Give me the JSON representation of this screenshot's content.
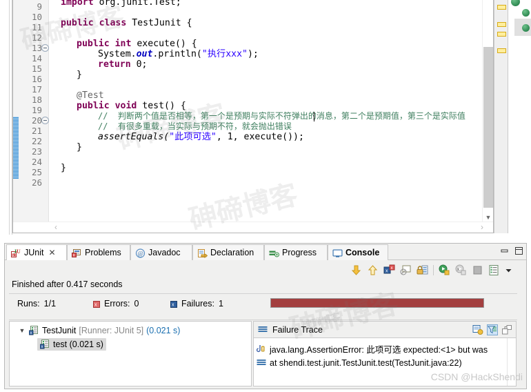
{
  "editor": {
    "lines": [
      {
        "num": "9",
        "fold": false,
        "change": false
      },
      {
        "num": "10",
        "fold": false,
        "change": false
      },
      {
        "num": "11",
        "fold": false,
        "change": false
      },
      {
        "num": "12",
        "fold": false,
        "change": false
      },
      {
        "num": "13",
        "fold": true,
        "change": false
      },
      {
        "num": "14",
        "fold": false,
        "change": false
      },
      {
        "num": "15",
        "fold": false,
        "change": false
      },
      {
        "num": "16",
        "fold": false,
        "change": false
      },
      {
        "num": "17",
        "fold": false,
        "change": false
      },
      {
        "num": "18",
        "fold": true,
        "change": true
      },
      {
        "num": "19",
        "fold": false,
        "change": true
      },
      {
        "num": "20",
        "fold": false,
        "change": true
      },
      {
        "num": "21",
        "fold": false,
        "change": true
      },
      {
        "num": "22",
        "fold": false,
        "change": true
      },
      {
        "num": "23",
        "fold": false,
        "change": true
      },
      {
        "num": "24",
        "fold": false,
        "change": false
      },
      {
        "num": "25",
        "fold": false,
        "change": false
      },
      {
        "num": "26",
        "fold": false,
        "change": false
      }
    ],
    "code": {
      "l9_import": "import",
      "l9_rest": " org.junit.Test;",
      "l11_public": "public",
      "l11_class": "class",
      "l11_rest": " TestJunit {",
      "l13_public": "public",
      "l13_int": "int",
      "l13_rest": " execute() {",
      "l14_a": "System.",
      "l14_out": "out",
      "l14_b": ".println(",
      "l14_str": "\"执行xxx\"",
      "l14_c": ");",
      "l15_return": "return",
      "l15_rest": " 0;",
      "l16": "}",
      "l18_annotation": "@Test",
      "l19_public": "public",
      "l19_void": "void",
      "l19_rest": " test() {",
      "l20_comment": "//  判断两个值是否相等，第一个是预期与实际不符弹出的消息，第二个是预期值，第三个是实际值",
      "l21_comment": "//  有很多重载，当实际与预期不符，就会抛出错误",
      "l22_mth": "assertEquals(",
      "l22_str": "\"此项可选\"",
      "l22_rest": ", 1, execute());",
      "l23": "}",
      "l25": "}"
    },
    "scrollbar": {
      "left_arrow": "‹",
      "right_arrow": "›",
      "down_arrow": "▼"
    }
  },
  "junit_view": {
    "tabs": [
      {
        "label": "JUnit",
        "icon": "junit-icon",
        "active": true,
        "closable": true
      },
      {
        "label": "Problems",
        "icon": "problems-icon",
        "active": false,
        "closable": false
      },
      {
        "label": "Javadoc",
        "icon": "javadoc-icon",
        "active": false,
        "closable": false
      },
      {
        "label": "Declaration",
        "icon": "declaration-icon",
        "active": false,
        "closable": false
      },
      {
        "label": "Progress",
        "icon": "progress-icon",
        "active": false,
        "closable": false
      },
      {
        "label": "Console",
        "icon": "console-icon",
        "active": false,
        "closable": false
      }
    ],
    "panel_buttons": [
      {
        "name": "minimize-button"
      },
      {
        "name": "maximize-button"
      }
    ],
    "toolbar_icons": [
      {
        "name": "next-failure-icon"
      },
      {
        "name": "previous-failure-icon"
      },
      {
        "name": "show-failures-only-icon"
      },
      {
        "name": "stop-on-error-icon"
      },
      {
        "name": "scroll-lock-icon"
      },
      {
        "name": "rerun-test-icon"
      },
      {
        "name": "rerun-failed-tests-icon"
      },
      {
        "name": "stop-icon"
      },
      {
        "name": "test-run-history-icon"
      },
      {
        "name": "view-menu-chevron-icon"
      },
      {
        "name": "view-menu-icon"
      }
    ],
    "status_text": "Finished after 0.417 seconds",
    "counters": [
      {
        "name": "runs-counter",
        "label": "Runs:",
        "value": "1/1",
        "icon": false
      },
      {
        "name": "errors-counter",
        "label": "Errors:",
        "value": "0",
        "icon": true,
        "color": "#c0504d"
      },
      {
        "name": "failures-counter",
        "label": "Failures:",
        "value": "1",
        "icon": true,
        "color": "#1f5b9e"
      }
    ],
    "progress": {
      "state": "failed",
      "color": "#a33f3f",
      "percent": 100
    },
    "tree": [
      {
        "label": "TestJunit",
        "runner": "[Runner: JUnit 5]",
        "duration": "(0.021 s)",
        "expanded": true,
        "selected": false,
        "depth": 0
      },
      {
        "label": "test (0.021 s)",
        "runner": "",
        "duration": "",
        "expanded": false,
        "selected": true,
        "depth": 1
      }
    ],
    "failure_trace": {
      "title": "Failure Trace",
      "buttons": [
        {
          "name": "compare-result-icon",
          "selected": false
        },
        {
          "name": "filter-stack-trace-icon",
          "selected": true
        },
        {
          "name": "copy-trace-icon",
          "selected": false
        }
      ],
      "rows": [
        {
          "icon": "exception-icon",
          "text": "java.lang.AssertionError: 此项可选 expected:<1> but was"
        },
        {
          "icon": "stackframe-icon",
          "text": "at shendi.test.junit.TestJunit.test(TestJunit.java:22)"
        }
      ]
    }
  },
  "watermarks": {
    "blog": "砷碲博客",
    "csdn": "CSDN @HackShendi"
  },
  "colors": {
    "keyword": "#7f0055",
    "string": "#2a00ff",
    "comment": "#3f7f5f",
    "field": "#0000c0",
    "failure_bar": "#a33f3f",
    "selection": "#e8f2fc",
    "link": "#1a6fb0"
  }
}
